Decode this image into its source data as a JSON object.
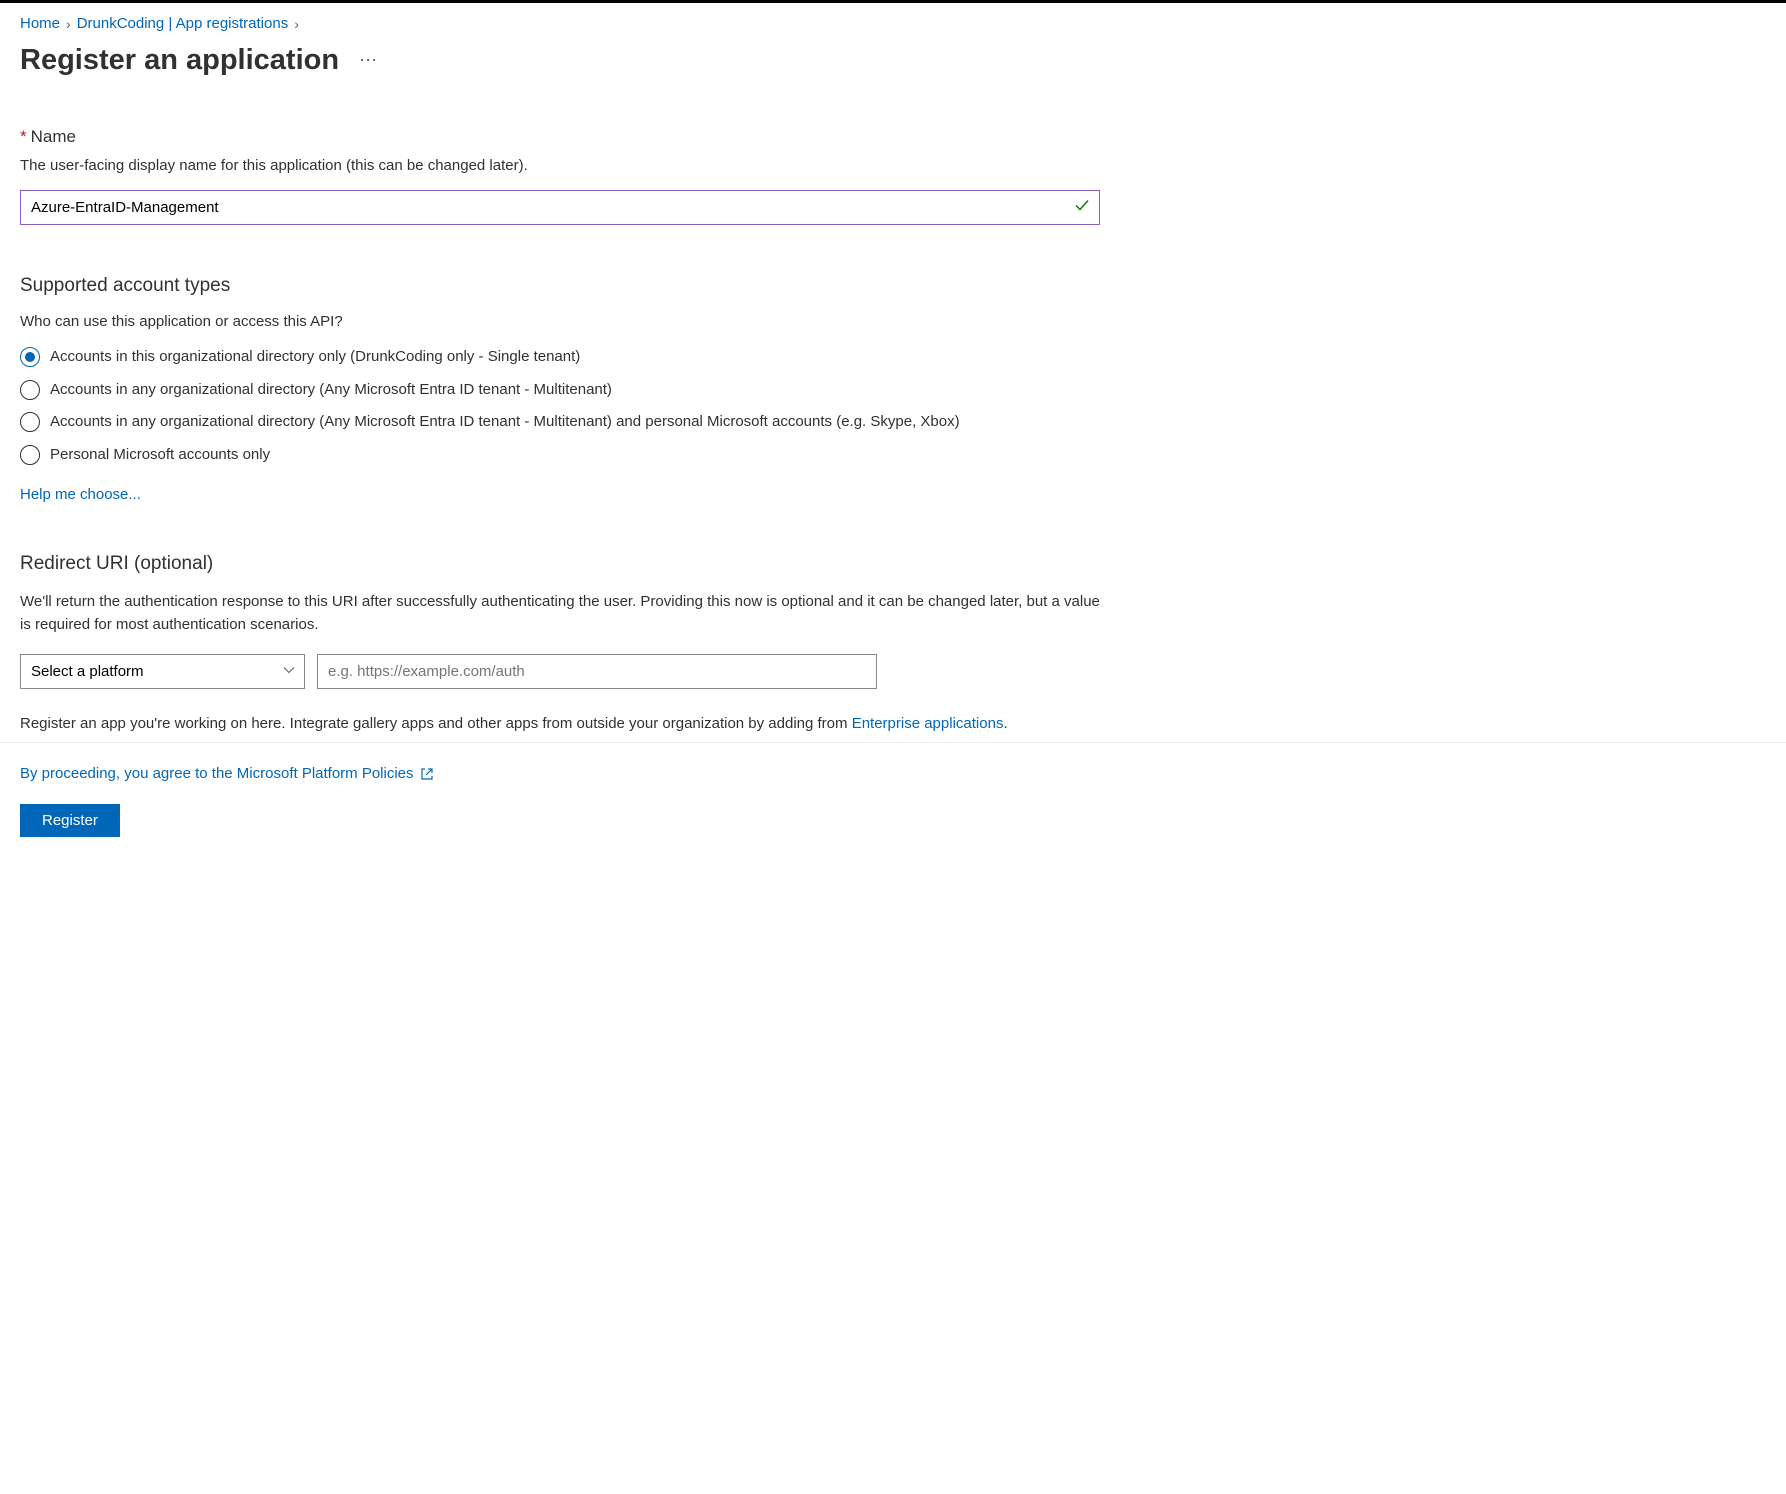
{
  "breadcrumb": {
    "home": "Home",
    "middle": "DrunkCoding | App registrations"
  },
  "page_title": "Register an application",
  "name_section": {
    "label": "Name",
    "description": "The user-facing display name for this application (this can be changed later).",
    "value": "Azure-EntraID-Management"
  },
  "account_types": {
    "heading": "Supported account types",
    "question": "Who can use this application or access this API?",
    "options": [
      "Accounts in this organizational directory only (DrunkCoding only - Single tenant)",
      "Accounts in any organizational directory (Any Microsoft Entra ID tenant - Multitenant)",
      "Accounts in any organizational directory (Any Microsoft Entra ID tenant - Multitenant) and personal Microsoft accounts (e.g. Skype, Xbox)",
      "Personal Microsoft accounts only"
    ],
    "selected_index": 0,
    "help_link": "Help me choose..."
  },
  "redirect": {
    "heading": "Redirect URI (optional)",
    "description": "We'll return the authentication response to this URI after successfully authenticating the user. Providing this now is optional and it can be changed later, but a value is required for most authentication scenarios.",
    "platform_placeholder": "Select a platform",
    "uri_placeholder": "e.g. https://example.com/auth"
  },
  "note": {
    "text_before": "Register an app you're working on here. Integrate gallery apps and other apps from outside your organization by adding from ",
    "link": "Enterprise applications",
    "text_after": "."
  },
  "policy_link": "By proceeding, you agree to the Microsoft Platform Policies",
  "register_button": "Register"
}
